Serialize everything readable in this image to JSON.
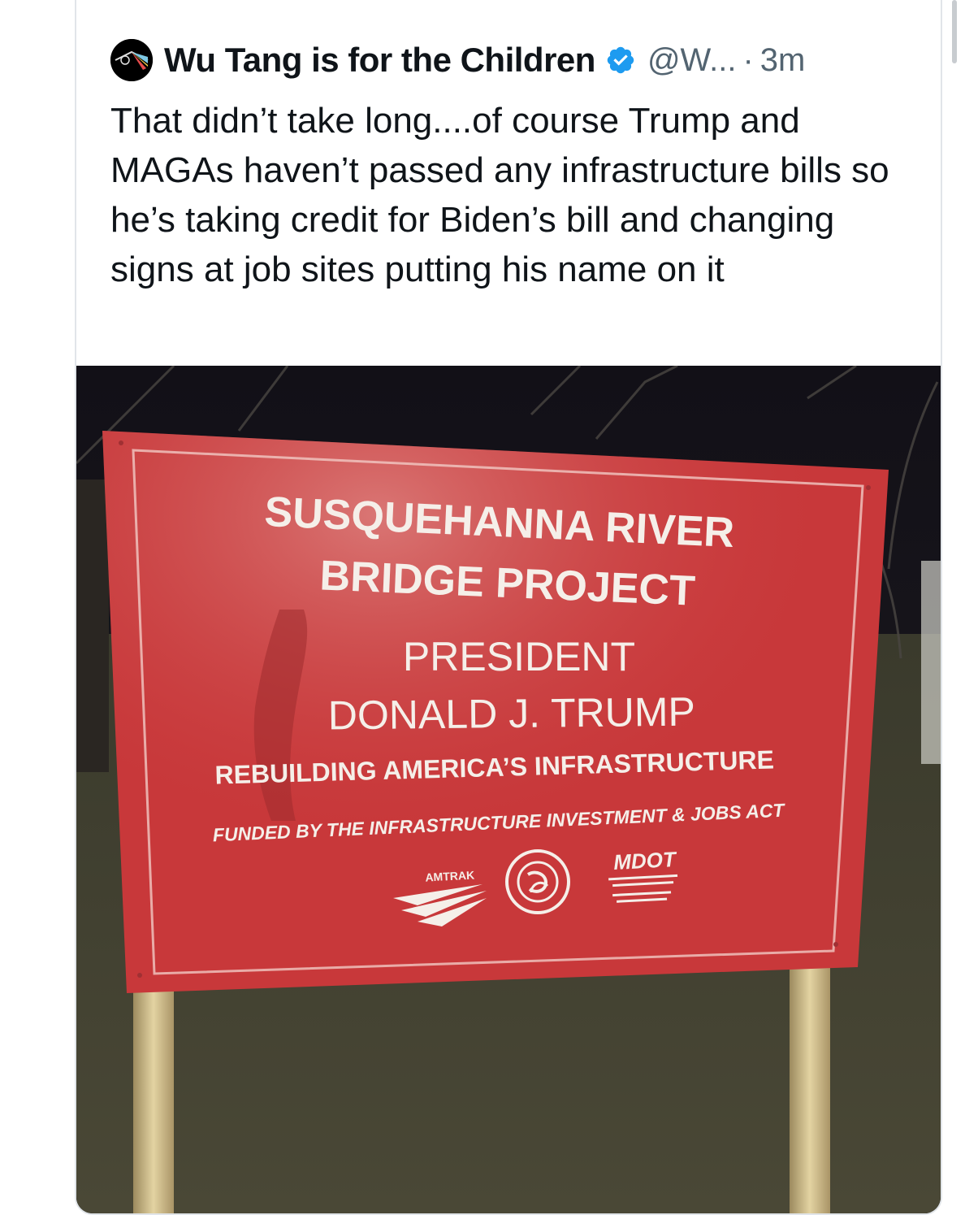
{
  "tweet": {
    "author_name": "Wu Tang is for the Children",
    "handle": "@W...",
    "separator": "·",
    "time": "3m",
    "text": "That didn’t take long....of course Trump and MAGAs haven’t passed any infrastructure bills so he’s taking credit for Biden’s bill and changing signs at job sites putting his name on it",
    "avatar_icon": "wu-tang-logo-icon",
    "verified_icon": "verified-badge-icon"
  },
  "sign": {
    "line1": "SUSQUEHANNA RIVER",
    "line2": "BRIDGE PROJECT",
    "line3": "PRESIDENT",
    "line4": "DONALD J. TRUMP",
    "line5": "REBUILDING AMERICA’S INFRASTRUCTURE",
    "line6": "FUNDED BY THE INFRASTRUCTURE INVESTMENT & JOBS ACT",
    "logo_amtrak": "AMTRAK",
    "logo_mdot": "MDOT"
  },
  "colors": {
    "sign_red": "#c8383a",
    "verified_blue": "#1d9bf0",
    "handle_gray": "#536471"
  }
}
